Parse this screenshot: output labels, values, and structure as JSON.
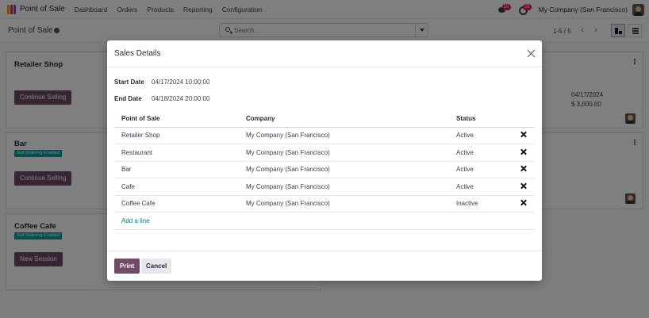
{
  "navbar": {
    "app_name": "Point of Sale",
    "menu": [
      "Dashboard",
      "Orders",
      "Products",
      "Reporting",
      "Configuration"
    ],
    "messages_count": "10",
    "activities_count": "25",
    "company": "My Company (San Francisco)"
  },
  "control": {
    "title": "Point of Sale",
    "search_placeholder": "Search...",
    "pager": "1-5 / 5",
    "prev_icon": "‹",
    "next_icon": "›"
  },
  "kanban": {
    "cards": [
      {
        "name": "Retailer Shop",
        "badge": "",
        "button": "Continue Selling"
      },
      {
        "name": "Bar",
        "badge": "Self Ordering Enabled",
        "button": "Continue Selling"
      },
      {
        "name": "Coffee Cafe",
        "badge": "Self Ordering Enabled",
        "button": "New Session"
      }
    ],
    "right_card": {
      "date": "04/17/2024",
      "amount": "$ 3,000.00"
    }
  },
  "modal": {
    "title": "Sales Details",
    "start_date_label": "Start Date",
    "start_date": "04/17/2024 10:00:00",
    "end_date_label": "End Date",
    "end_date": "04/18/2024 20:00:00",
    "columns": [
      "Point of Sale",
      "Company",
      "Status"
    ],
    "rows": [
      {
        "pos": "Retailer Shop",
        "company": "My Company (San Francisco)",
        "status": "Active"
      },
      {
        "pos": "Restaurant",
        "company": "My Company (San Francisco)",
        "status": "Active"
      },
      {
        "pos": "Bar",
        "company": "My Company (San Francisco)",
        "status": "Active"
      },
      {
        "pos": "Cafe",
        "company": "My Company (San Francisco)",
        "status": "Active"
      },
      {
        "pos": "Coffee Cafe",
        "company": "My Company (San Francisco)",
        "status": "Inactive"
      }
    ],
    "add_line": "Add a line",
    "print": "Print",
    "cancel": "Cancel"
  },
  "colors": {
    "brand": "#714b67",
    "self_ordering_badge": "#00a09d",
    "link": "#017e84",
    "notification_badge": "#e11d48"
  }
}
